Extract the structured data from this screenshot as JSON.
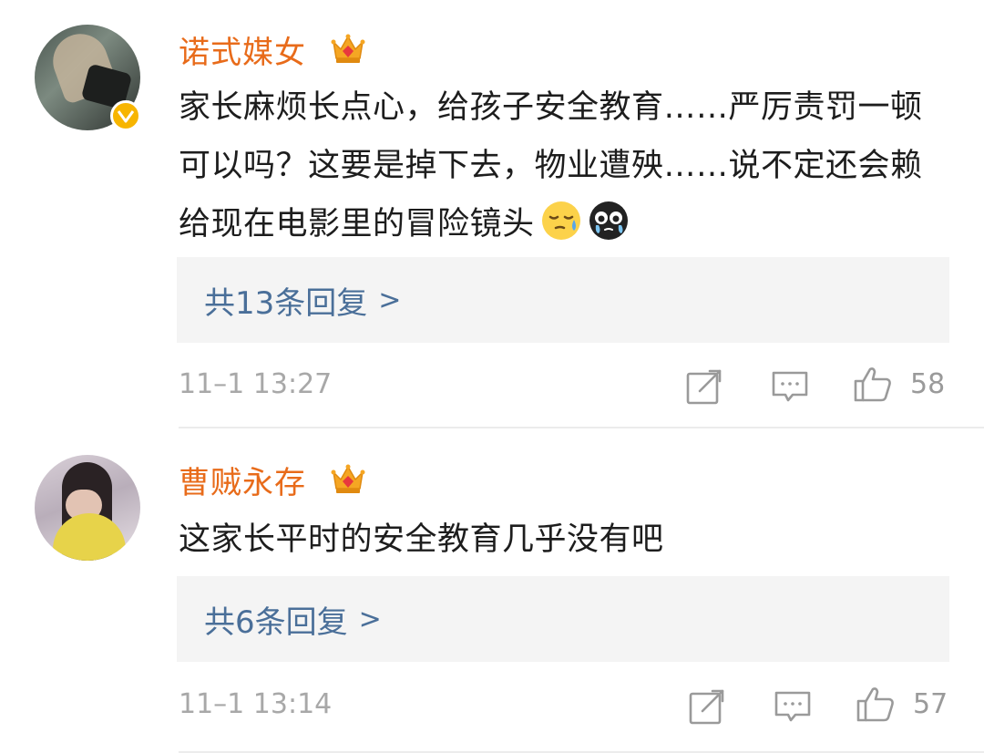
{
  "comments": [
    {
      "username": "诺式媒女",
      "text_before_emoji": "家长麻烦长点心，给孩子安全教育……严厉责罚一顿可以吗？这要是掉下去，物业遭殃……说不定还会赖给现在电影里的冒险镜头",
      "emojis": [
        "sweat-face-emoji",
        "crying-dark-emoji"
      ],
      "replies_label": "共13条回复",
      "replies_chevron": ">",
      "timestamp": "11–1 13:27",
      "like_count": "58",
      "verified": true,
      "vip_badge": "crown-vip-icon"
    },
    {
      "username": "曹贼永存",
      "text_before_emoji": "这家长平时的安全教育几乎没有吧",
      "emojis": [],
      "replies_label": "共6条回复",
      "replies_chevron": ">",
      "timestamp": "11–1 13:14",
      "like_count": "57",
      "verified": false,
      "vip_badge": "crown-vip-icon"
    }
  ],
  "colors": {
    "username": "#e86b1a",
    "reply_link": "#4a6f99",
    "meta_gray": "#a8a8a8",
    "reply_bg": "#f4f4f4",
    "verified": "#f7b500"
  }
}
